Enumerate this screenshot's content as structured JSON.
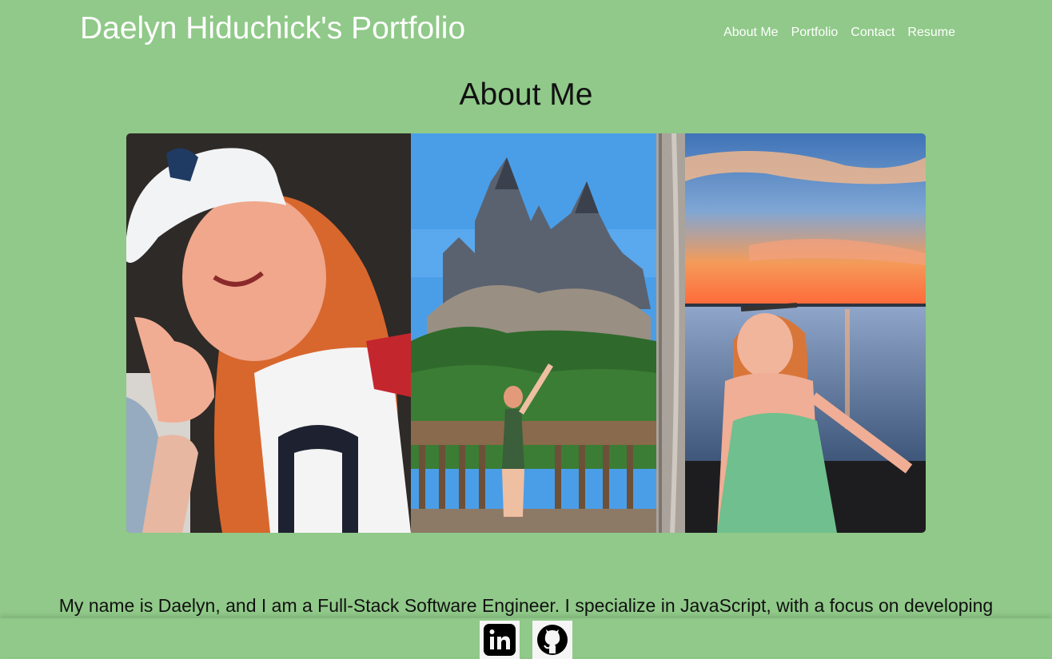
{
  "header": {
    "site_title": "Daelyn Hiduchick's Portfolio",
    "nav": [
      "About Me",
      "Portfolio",
      "Contact",
      "Resume"
    ]
  },
  "main": {
    "heading": "About Me",
    "bio": "My name is Daelyn, and I am a Full-Stack Software Engineer. I specialize in JavaScript, with a focus on developing React applications. Originally from Massachusetts, I am currently looking to relocate to Florida. Before transitioning"
  },
  "footer": {
    "links": [
      "linkedin-icon",
      "github-icon"
    ]
  },
  "colors": {
    "background": "#90c989",
    "title_text": "#ffffff",
    "body_text": "#111111"
  }
}
